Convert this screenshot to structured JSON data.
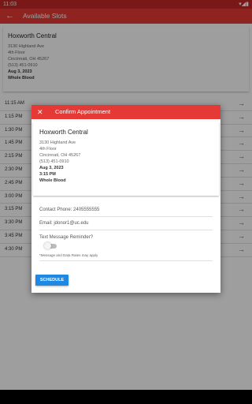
{
  "status_bar": {
    "time": "11:03",
    "icons": "▾◢▮"
  },
  "app_bar": {
    "title": "Available Slots"
  },
  "location": {
    "name": "Hoxworth Central",
    "address_lines": [
      "3130 Highland Ave",
      "4th Floor",
      "Cincinnati, OH 45267",
      "(513) 451-0910"
    ],
    "date": "Aug 3, 2023",
    "donation_type": "Whole Blood"
  },
  "slots": [
    "11:15 AM",
    "1:15 PM",
    "1:30 PM",
    "1:45 PM",
    "2:15 PM",
    "2:30 PM",
    "2:45 PM",
    "3:00 PM",
    "3:15 PM",
    "3:30 PM",
    "3:45 PM",
    "4:30 PM"
  ],
  "dialog": {
    "title": "Confirm Appointment",
    "location_name": "Hoxworth Central",
    "address_lines": [
      "3130 Highland Ave",
      "4th Floor",
      "Cincinnati, OH 45267",
      "(513) 451-0910"
    ],
    "date": "Aug 3, 2023",
    "time": "3:15 PM",
    "donation_type": "Whole Blood",
    "contact_phone": "Contact Phone:  2405555555",
    "email": "Email:  jdonor1@uc.edu",
    "reminder_label": "Text Message Reminder?",
    "reminder_on": false,
    "rates_note": "*Message and Data Rates may apply",
    "schedule_label": "SCHEDULE"
  },
  "colors": {
    "primary": "#e53935",
    "status": "#c62828",
    "button": "#1e88e5"
  },
  "icons": {
    "back": "arrow-left-icon",
    "close": "close-icon",
    "slot_arrow": "arrow-right-icon"
  }
}
